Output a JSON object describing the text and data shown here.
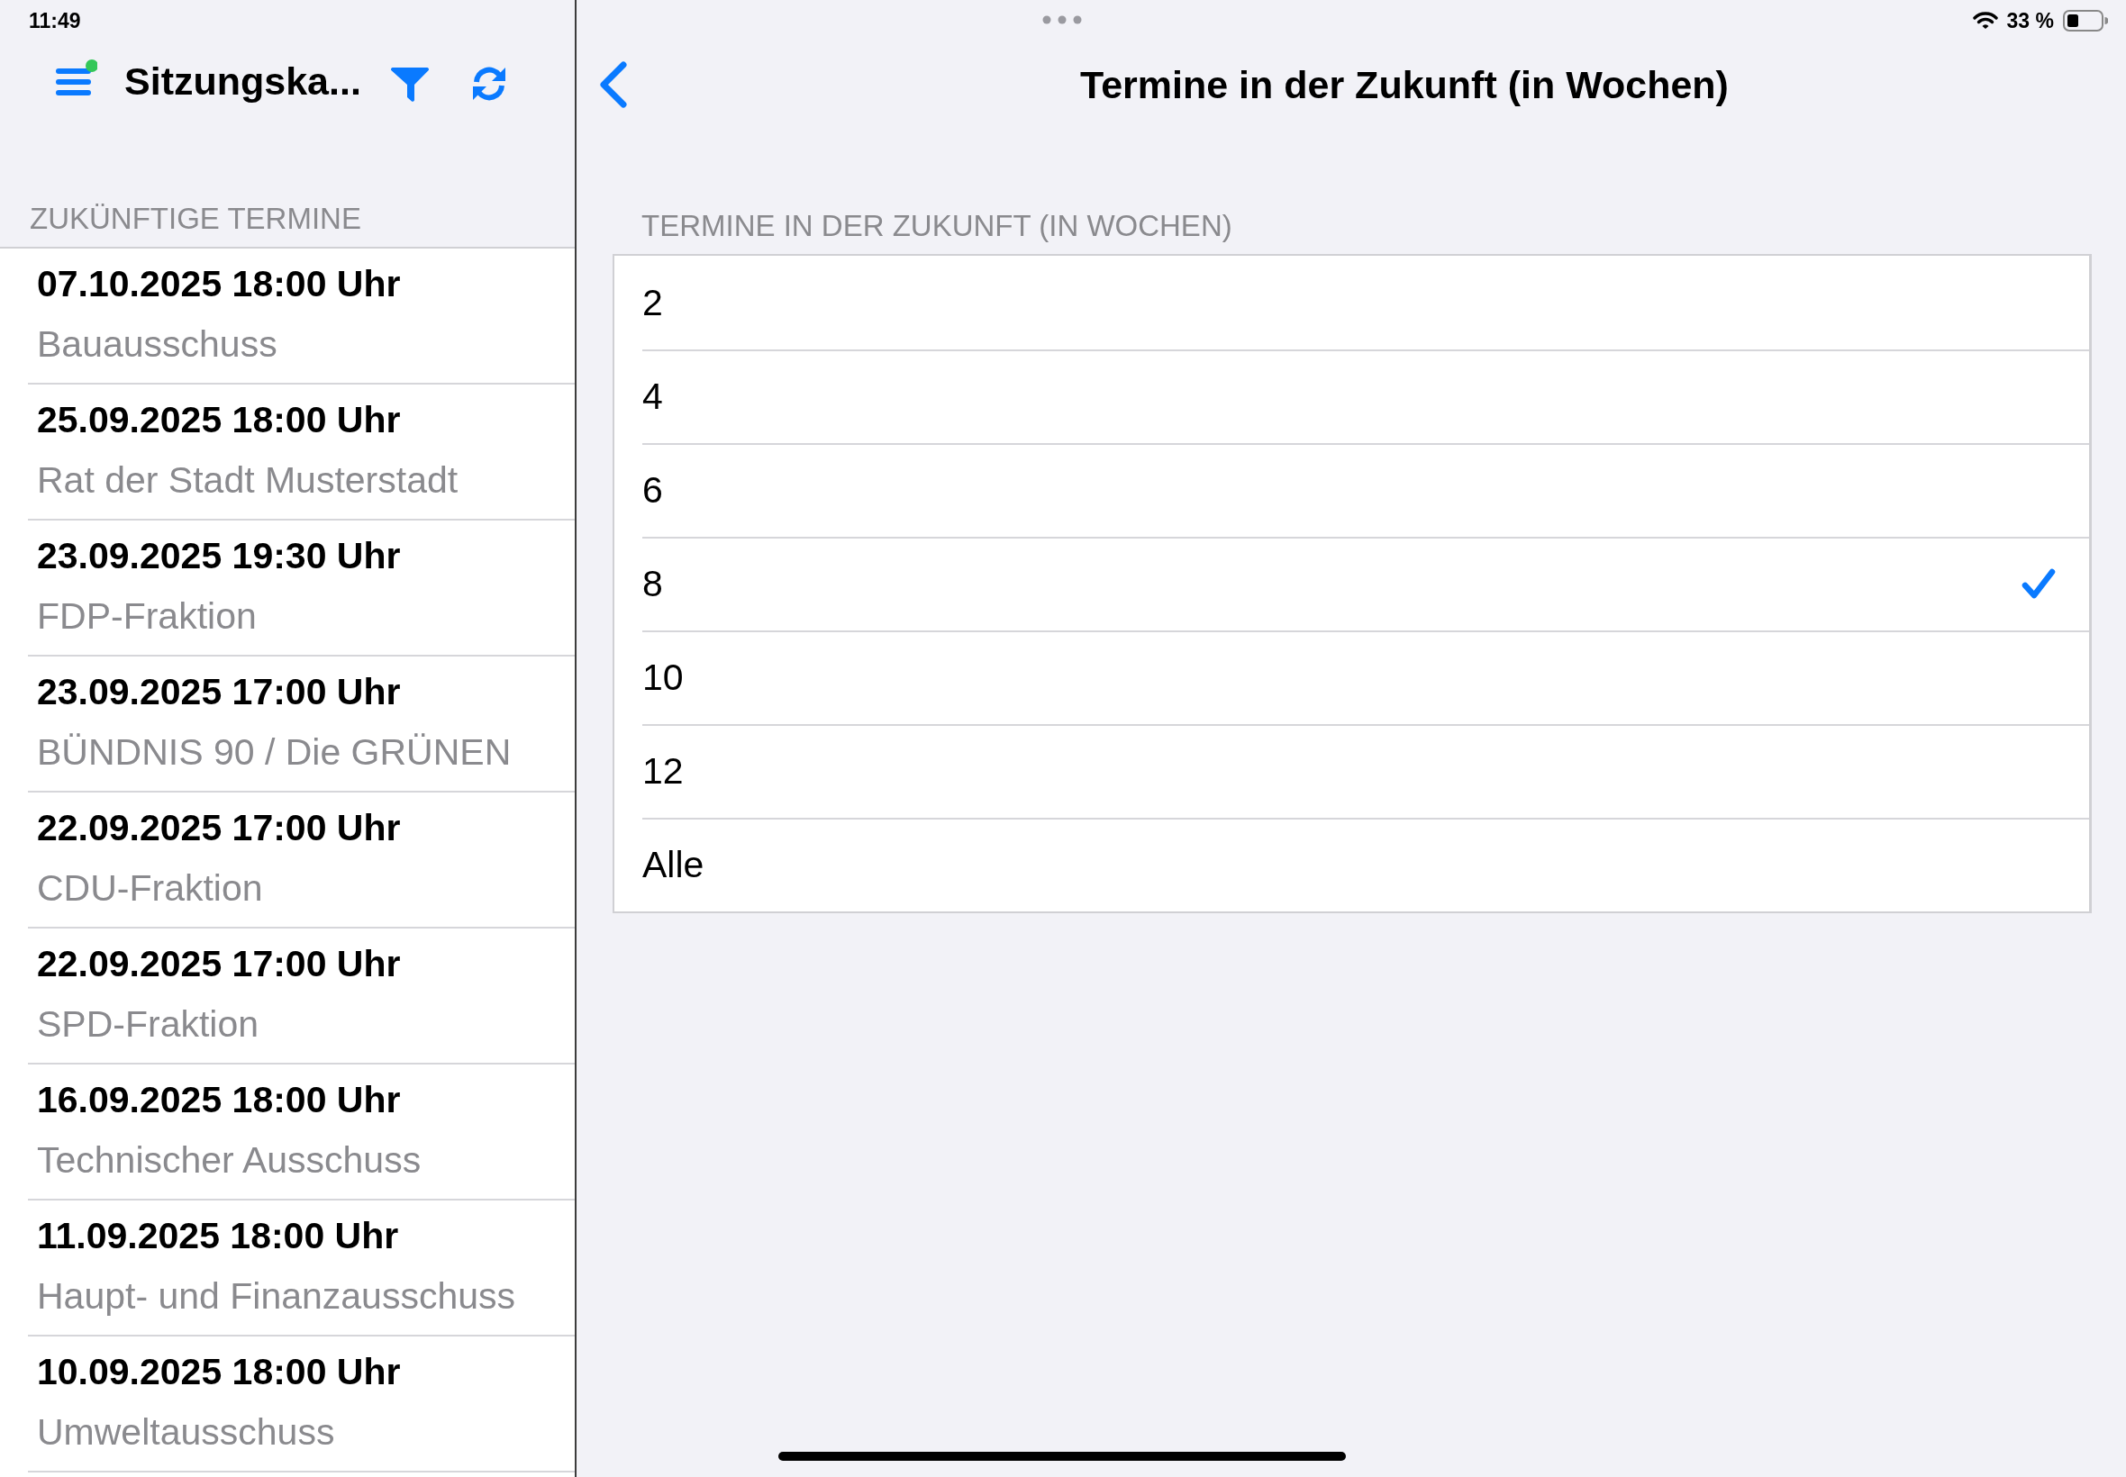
{
  "status_bar": {
    "time": "11:49",
    "battery": "33 %"
  },
  "master": {
    "title": "Sitzungska...",
    "section_header": "ZUKÜNFTIGE TERMINE",
    "appointments": [
      {
        "date": "07.10.2025 18:00 Uhr",
        "name": "Bauausschuss"
      },
      {
        "date": "25.09.2025 18:00 Uhr",
        "name": "Rat der Stadt Musterstadt"
      },
      {
        "date": "23.09.2025 19:30 Uhr",
        "name": "FDP-Fraktion"
      },
      {
        "date": "23.09.2025 17:00 Uhr",
        "name": "BÜNDNIS 90 / Die GRÜNEN"
      },
      {
        "date": "22.09.2025 17:00 Uhr",
        "name": "CDU-Fraktion"
      },
      {
        "date": "22.09.2025 17:00 Uhr",
        "name": "SPD-Fraktion"
      },
      {
        "date": "16.09.2025 18:00 Uhr",
        "name": "Technischer Ausschuss"
      },
      {
        "date": "11.09.2025 18:00 Uhr",
        "name": "Haupt- und Finanzausschuss"
      },
      {
        "date": "10.09.2025 18:00 Uhr",
        "name": "Umweltausschuss"
      }
    ]
  },
  "detail": {
    "title": "Termine in der Zukunft (in Wochen)",
    "section_header": "TERMINE IN DER ZUKUNFT (IN WOCHEN)",
    "options": [
      {
        "label": "2",
        "selected": false
      },
      {
        "label": "4",
        "selected": false
      },
      {
        "label": "6",
        "selected": false
      },
      {
        "label": "8",
        "selected": true
      },
      {
        "label": "10",
        "selected": false
      },
      {
        "label": "12",
        "selected": false
      },
      {
        "label": "Alle",
        "selected": false
      }
    ]
  }
}
